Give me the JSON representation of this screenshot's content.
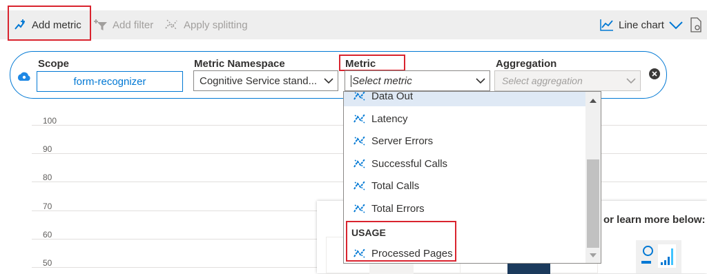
{
  "toolbar": {
    "add_metric": "Add metric",
    "add_filter": "Add filter",
    "apply_splitting": "Apply splitting",
    "chart_type": "Line chart"
  },
  "metric_row": {
    "scope_label": "Scope",
    "scope_value": "form-recognizer",
    "namespace_label": "Metric Namespace",
    "namespace_value": "Cognitive Service stand...",
    "metric_label": "Metric",
    "metric_placeholder": "Select metric",
    "aggregation_label": "Aggregation",
    "aggregation_placeholder": "Select aggregation"
  },
  "chart": {
    "y_ticks": [
      "100",
      "90",
      "80",
      "70",
      "60",
      "50"
    ]
  },
  "info_card": {
    "text": "or learn more below:"
  },
  "dropdown": {
    "items": [
      "Data Out",
      "Latency",
      "Server Errors",
      "Successful Calls",
      "Total Calls",
      "Total Errors"
    ],
    "group_header": "USAGE",
    "usage_items": [
      "Processed Pages"
    ]
  },
  "colors": {
    "accent": "#0078d4",
    "highlight_box": "#d9232e"
  }
}
